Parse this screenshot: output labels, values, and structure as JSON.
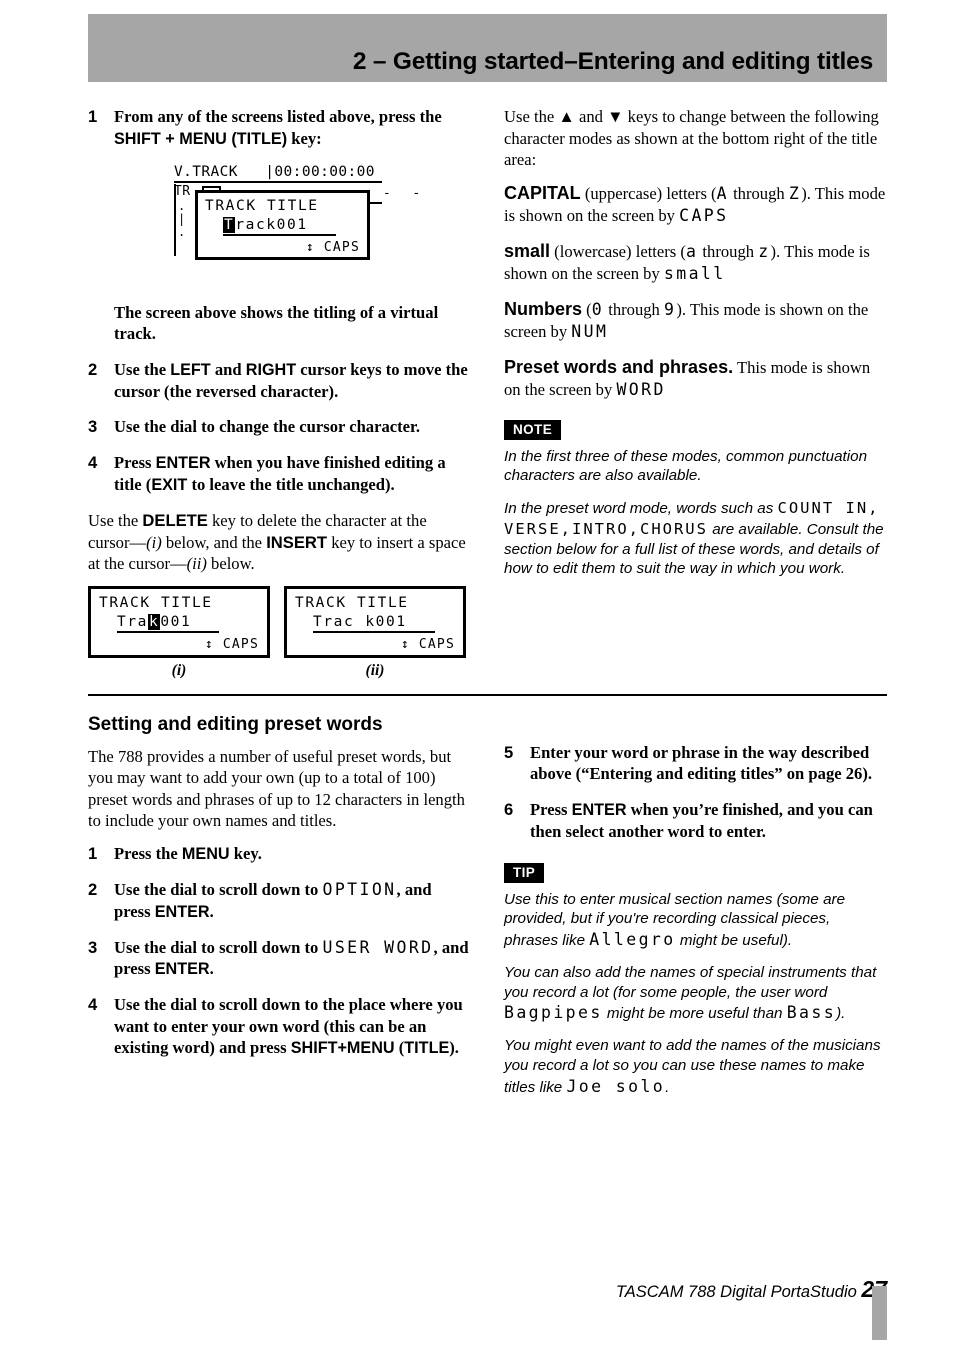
{
  "header": {
    "title": "2 – Getting started–Entering and editing titles",
    "band_color": "#a6a6a6"
  },
  "left_column": {
    "step1": {
      "num": "1",
      "text_a": "From any of the screens listed above, press the ",
      "text_b": "SHIFT + MENU (TITLE)",
      "text_c": " key:"
    },
    "figure1": {
      "background_row1": "V.TRACK   |00:00:00:00",
      "background_row2": "TR",
      "dashes": "-  -  -  -  -  -  -  -",
      "dialog_title": "TRACK TITLE",
      "dialog_value_cursor": "T",
      "dialog_value_rest": "rack001",
      "dialog_mode": "↕ CAPS"
    },
    "caption_after_fig1": "The screen above shows the titling of a virtual track.",
    "step2": {
      "num": "2",
      "text_a": "Use the ",
      "key1": "LEFT",
      "text_b": " and ",
      "key2": "RIGHT",
      "text_c": " cursor keys to move the cursor (the reversed character)."
    },
    "step3": {
      "num": "3",
      "text": "Use the dial to change the cursor character."
    },
    "step4": {
      "num": "4",
      "text_a": "Press ",
      "key1": "ENTER",
      "text_b": " when you have finished editing a title (",
      "key2": "EXIT",
      "text_c": " to leave the title unchanged)."
    },
    "delete_para": {
      "a": "Use the ",
      "key1": "DELETE",
      "b": " key to delete the character at the cursor—",
      "i1": "(i)",
      "c": " below, and the ",
      "key2": "INSERT",
      "d": " key to insert a space at the cursor—",
      "i2": "(ii)",
      "e": " below."
    },
    "figure_i": {
      "title": "TRACK TITLE",
      "value_before": "Tra",
      "value_cursor": "k",
      "value_after": "001",
      "mode": "↕ CAPS",
      "caption": "(i)"
    },
    "figure_ii": {
      "title": "TRACK TITLE",
      "value_before": "Trac",
      "value_cursor": " ",
      "value_after": "k001",
      "mode": "↕ CAPS",
      "caption": "(ii)"
    },
    "section": {
      "heading": "Setting and editing preset words",
      "intro": "The 788 provides a number of useful preset words, but you may want to add your own (up to a total of 100) preset words and phrases of up to 12 characters in length to include your own names and titles.",
      "step1": {
        "num": "1",
        "text_a": "Press the ",
        "key1": "MENU",
        "text_b": " key."
      },
      "step2": {
        "num": "2",
        "text_a": "Use the dial to scroll down to ",
        "lcd": "OPTION",
        "text_b": ", and press ",
        "key1": "ENTER",
        "text_c": "."
      },
      "step3": {
        "num": "3",
        "text_a": "Use the dial to scroll down to ",
        "lcd": "USER WORD",
        "text_b": ", and press ",
        "key1": "ENTER",
        "text_c": "."
      },
      "step4": {
        "num": "4",
        "text_a": "Use the dial to scroll down to the place where you want to enter your own word (this can be an existing word) and press ",
        "key1": "SHIFT+MENU",
        "text_b": " (",
        "key2": "TITLE",
        "text_c": ")."
      }
    }
  },
  "right_column": {
    "intro": {
      "a": "Use the ",
      "up_arrow": "▲",
      "b": " and ",
      "down_arrow": "▼",
      "c": " keys to change between the following character modes as shown at the bottom right of the title area:"
    },
    "mode_capital": {
      "name": "CAPITAL",
      "a": " (uppercase) letters (",
      "lcd1": "A",
      "b": " through ",
      "lcd2": "Z",
      "c": "). This mode is shown on the screen by ",
      "lcd3": "CAPS"
    },
    "mode_small": {
      "name": "small",
      "a": " (lowercase) letters (",
      "lcd1": "a",
      "b": " through ",
      "lcd2": "z",
      "c": "). This mode is shown on the screen by ",
      "lcd3": "small"
    },
    "mode_numbers": {
      "name": "Numbers",
      "a": " (",
      "lcd1": "0",
      "b": " through ",
      "lcd2": "9",
      "c": "). This mode is shown on the screen by ",
      "lcd3": "NUM"
    },
    "mode_preset": {
      "name": "Preset words and phrases.",
      "a": "  This mode is shown on the screen by ",
      "lcd3": "WORD"
    },
    "note": {
      "badge": "NOTE",
      "para1": "In the first three of these modes, common punctuation characters are also available.",
      "para2_a": "In the preset word mode, words such as ",
      "para2_lcd": "COUNT IN,\nVERSE,INTRO,CHORUS",
      "para2_b": " are available. Consult the section below for a full list of these words, and details of how to edit them to suit the way in which you work."
    },
    "step5": {
      "num": "5",
      "text": "Enter your word or phrase in the way described above (“Entering and editing titles” on page 26)."
    },
    "step6": {
      "num": "6",
      "text_a": "Press ",
      "key1": "ENTER",
      "text_b": " when you’re finished, and you can then select another word to enter."
    },
    "tip": {
      "badge": "TIP",
      "para1_a": "Use this to enter musical section names (some are provided, but if you're recording classical pieces, phrases like ",
      "para1_lcd": "Allegro",
      "para1_b": " might be useful).",
      "para2_a": "You can also add the names of special instruments that you record a lot (for some people, the user word ",
      "para2_lcd1": "Bagpipes",
      "para2_b": " might be more useful than ",
      "para2_lcd2": "Bass",
      "para2_c": ").",
      "para3_a": "You might even want to add the names of the musicians you record a lot so you can use these names to make titles like ",
      "para3_lcd": "Joe solo",
      "para3_b": "."
    }
  },
  "footer": {
    "text": "TASCAM 788 Digital PortaStudio ",
    "page": "27",
    "bar_color": "#a6a6a6"
  }
}
